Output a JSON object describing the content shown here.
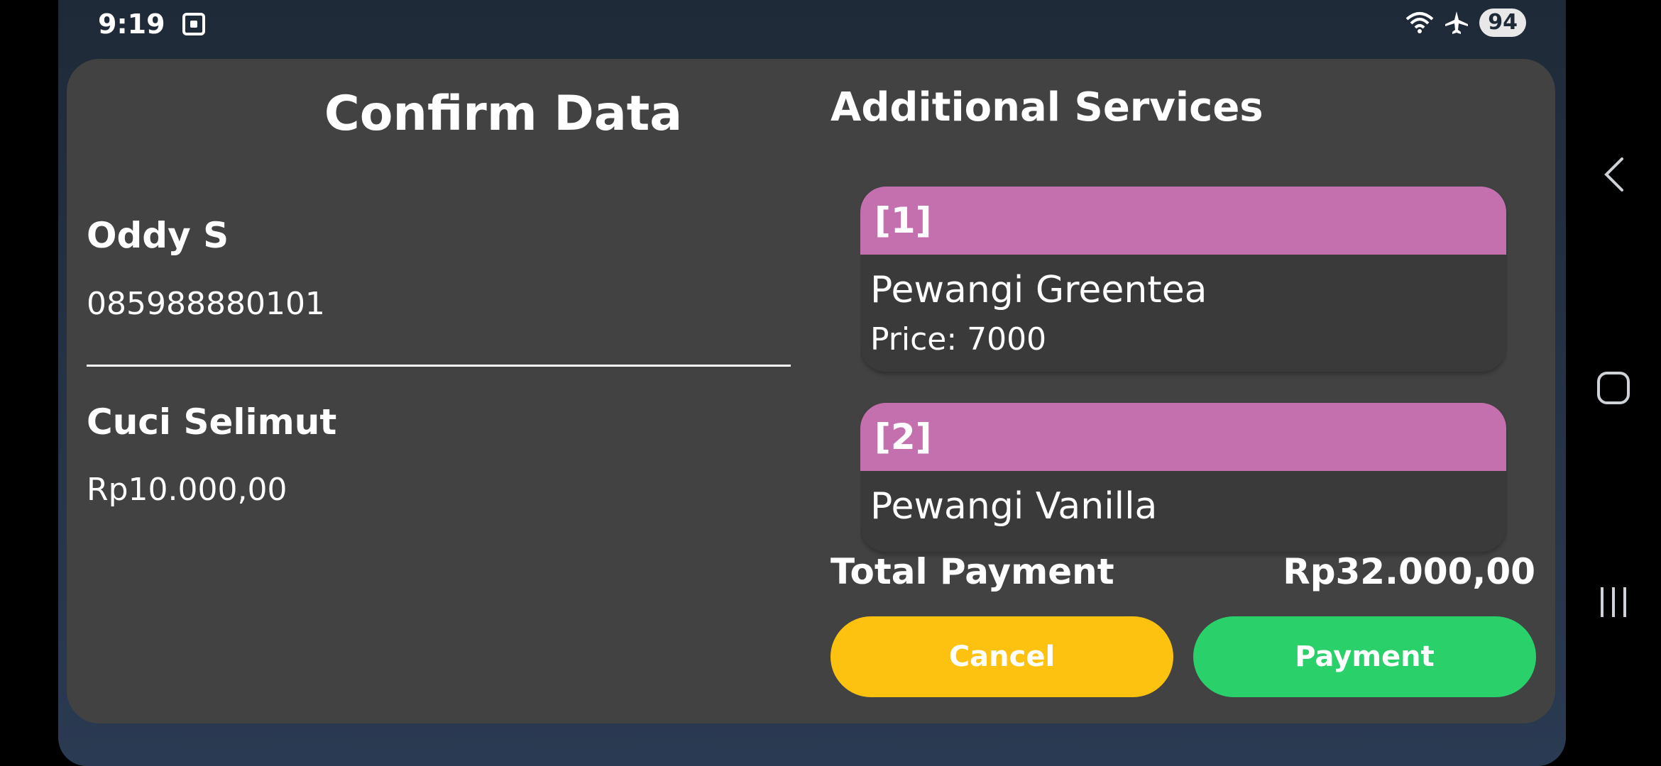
{
  "status_bar": {
    "time": "9:19",
    "battery": "94",
    "icons": [
      "screenshot-icon",
      "wifi-icon",
      "airplane-icon"
    ]
  },
  "confirm": {
    "title": "Confirm Data",
    "customer_name": "Oddy S",
    "customer_phone": "085988880101",
    "service_name": "Cuci Selimut",
    "service_price": "Rp10.000,00"
  },
  "additional": {
    "title": "Additional Services",
    "items": [
      {
        "index": "[1]",
        "name": "Pewangi Greentea",
        "price": "Price:  7000"
      },
      {
        "index": "[2]",
        "name": "Pewangi Vanilla",
        "price": ""
      }
    ]
  },
  "total": {
    "label": "Total Payment",
    "value": "Rp32.000,00"
  },
  "buttons": {
    "cancel": "Cancel",
    "payment": "Payment"
  },
  "colors": {
    "card_header": "#c46fae",
    "cancel": "#fcc20f",
    "payment": "#2ad06a",
    "dialog": "#424242"
  },
  "nav": [
    "back-icon",
    "home-icon",
    "recents-icon"
  ]
}
